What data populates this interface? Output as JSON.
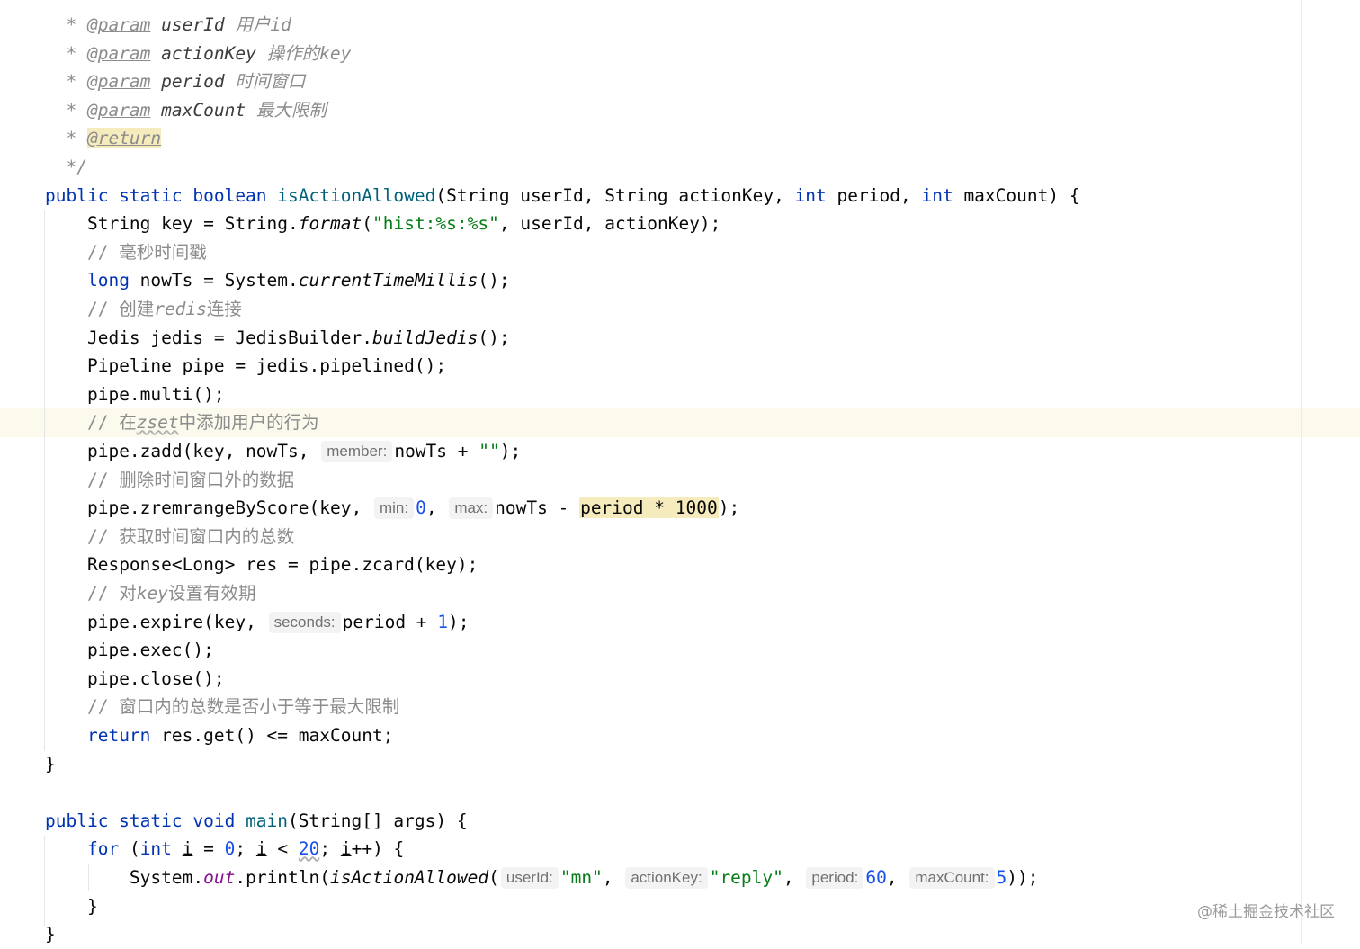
{
  "editor": {
    "lines": [
      {
        "indent": "  ",
        "tokens": [
          {
            "c": "cmt-it",
            "t": "* "
          },
          {
            "c": "doctag",
            "t": "@param"
          },
          {
            "c": "t",
            "t": " "
          },
          {
            "c": "docparam",
            "t": "userId"
          },
          {
            "c": "cmt-it",
            "t": " 用户id"
          }
        ]
      },
      {
        "indent": "  ",
        "tokens": [
          {
            "c": "cmt-it",
            "t": "* "
          },
          {
            "c": "doctag",
            "t": "@param"
          },
          {
            "c": "t",
            "t": " "
          },
          {
            "c": "docparam",
            "t": "actionKey"
          },
          {
            "c": "cmt-it",
            "t": " 操作的key"
          }
        ]
      },
      {
        "indent": "  ",
        "tokens": [
          {
            "c": "cmt-it",
            "t": "* "
          },
          {
            "c": "doctag",
            "t": "@param"
          },
          {
            "c": "t",
            "t": " "
          },
          {
            "c": "docparam",
            "t": "period"
          },
          {
            "c": "cmt-it",
            "t": " 时间窗口"
          }
        ]
      },
      {
        "indent": "  ",
        "tokens": [
          {
            "c": "cmt-it",
            "t": "* "
          },
          {
            "c": "doctag",
            "t": "@param"
          },
          {
            "c": "t",
            "t": " "
          },
          {
            "c": "docparam",
            "t": "maxCount"
          },
          {
            "c": "cmt-it",
            "t": " 最大限制"
          }
        ]
      },
      {
        "indent": "  ",
        "tokens": [
          {
            "c": "cmt-it",
            "t": "* "
          },
          {
            "c": "doctag hl-ret",
            "t": "@return"
          }
        ]
      },
      {
        "indent": "  ",
        "tokens": [
          {
            "c": "cmt-it",
            "t": "*/"
          }
        ]
      },
      {
        "indent": "",
        "tokens": [
          {
            "c": "kw",
            "t": "public static boolean "
          },
          {
            "c": "fn",
            "t": "isActionAllowed"
          },
          {
            "c": "t",
            "t": "(String userId, String actionKey, "
          },
          {
            "c": "kw",
            "t": "int"
          },
          {
            "c": "t",
            "t": " period, "
          },
          {
            "c": "kw",
            "t": "int"
          },
          {
            "c": "t",
            "t": " maxCount) {"
          }
        ]
      },
      {
        "indent": "    ",
        "tokens": [
          {
            "c": "t",
            "t": "String key = String."
          },
          {
            "c": "static-call",
            "t": "format"
          },
          {
            "c": "t",
            "t": "("
          },
          {
            "c": "str",
            "t": "\"hist:%s:%s\""
          },
          {
            "c": "t",
            "t": ", userId, actionKey);"
          }
        ]
      },
      {
        "indent": "    ",
        "tokens": [
          {
            "c": "cmt",
            "t": "// 毫秒时间戳"
          }
        ]
      },
      {
        "indent": "    ",
        "tokens": [
          {
            "c": "kw",
            "t": "long"
          },
          {
            "c": "t",
            "t": " nowTs = System."
          },
          {
            "c": "static-call",
            "t": "currentTimeMillis"
          },
          {
            "c": "t",
            "t": "();"
          }
        ]
      },
      {
        "indent": "    ",
        "tokens": [
          {
            "c": "cmt",
            "t": "// 创建"
          },
          {
            "c": "cmt-it",
            "t": "redis"
          },
          {
            "c": "cmt",
            "t": "连接"
          }
        ]
      },
      {
        "indent": "    ",
        "tokens": [
          {
            "c": "t",
            "t": "Jedis jedis = JedisBuilder."
          },
          {
            "c": "static-call",
            "t": "buildJedis"
          },
          {
            "c": "t",
            "t": "();"
          }
        ]
      },
      {
        "indent": "    ",
        "tokens": [
          {
            "c": "t",
            "t": "Pipeline pipe = jedis.pipelined();"
          }
        ]
      },
      {
        "indent": "    ",
        "tokens": [
          {
            "c": "t",
            "t": "pipe.multi();"
          }
        ]
      },
      {
        "indent": "    ",
        "caret": true,
        "tokens": [
          {
            "c": "cmt",
            "t": "// 在"
          },
          {
            "c": "cmt-it squig",
            "t": "zset"
          },
          {
            "c": "cmt",
            "t": "中添加用户的行为"
          }
        ]
      },
      {
        "indent": "    ",
        "tokens": [
          {
            "c": "t",
            "t": "pipe.zadd(key, nowTs, "
          },
          {
            "c": "hint",
            "t": "member:"
          },
          {
            "c": "t",
            "t": "nowTs + "
          },
          {
            "c": "str",
            "t": "\"\""
          },
          {
            "c": "t",
            "t": ");"
          }
        ]
      },
      {
        "indent": "    ",
        "tokens": [
          {
            "c": "cmt",
            "t": "// 删除时间窗口外的数据"
          }
        ]
      },
      {
        "indent": "    ",
        "tokens": [
          {
            "c": "t",
            "t": "pipe.zremrangeByScore(key, "
          },
          {
            "c": "hint",
            "t": "min:"
          },
          {
            "c": "num",
            "t": "0"
          },
          {
            "c": "t",
            "t": ", "
          },
          {
            "c": "hint",
            "t": "max:"
          },
          {
            "c": "t",
            "t": "nowTs - "
          },
          {
            "c": "hl-occ",
            "t": "period * 1000"
          },
          {
            "c": "t",
            "t": ");"
          }
        ]
      },
      {
        "indent": "    ",
        "tokens": [
          {
            "c": "cmt",
            "t": "// 获取时间窗口内的总数"
          }
        ]
      },
      {
        "indent": "    ",
        "tokens": [
          {
            "c": "t",
            "t": "Response<Long> res = pipe.zcard(key);"
          }
        ]
      },
      {
        "indent": "    ",
        "tokens": [
          {
            "c": "cmt",
            "t": "// 对"
          },
          {
            "c": "cmt-it",
            "t": "key"
          },
          {
            "c": "cmt",
            "t": "设置有效期"
          }
        ]
      },
      {
        "indent": "    ",
        "tokens": [
          {
            "c": "t",
            "t": "pipe."
          },
          {
            "c": "deprecated",
            "t": "expire"
          },
          {
            "c": "t",
            "t": "(key, "
          },
          {
            "c": "hint",
            "t": "seconds:"
          },
          {
            "c": "t",
            "t": "period + "
          },
          {
            "c": "num",
            "t": "1"
          },
          {
            "c": "t",
            "t": ");"
          }
        ]
      },
      {
        "indent": "    ",
        "tokens": [
          {
            "c": "t",
            "t": "pipe.exec();"
          }
        ]
      },
      {
        "indent": "    ",
        "tokens": [
          {
            "c": "t",
            "t": "pipe.close();"
          }
        ]
      },
      {
        "indent": "    ",
        "tokens": [
          {
            "c": "cmt",
            "t": "// 窗口内的总数是否小于等于最大限制"
          }
        ]
      },
      {
        "indent": "    ",
        "tokens": [
          {
            "c": "kw",
            "t": "return"
          },
          {
            "c": "t",
            "t": " res.get() <= maxCount;"
          }
        ]
      },
      {
        "indent": "",
        "tokens": [
          {
            "c": "t",
            "t": "}"
          }
        ]
      },
      {
        "indent": "",
        "tokens": []
      },
      {
        "indent": "",
        "tokens": [
          {
            "c": "kw",
            "t": "public static void "
          },
          {
            "c": "fn",
            "t": "main"
          },
          {
            "c": "t",
            "t": "(String[] args) {"
          }
        ]
      },
      {
        "indent": "    ",
        "tokens": [
          {
            "c": "kw",
            "t": "for"
          },
          {
            "c": "t",
            "t": " ("
          },
          {
            "c": "kw",
            "t": "int"
          },
          {
            "c": "t",
            "t": " "
          },
          {
            "c": "uvar",
            "t": "i"
          },
          {
            "c": "t",
            "t": " = "
          },
          {
            "c": "num",
            "t": "0"
          },
          {
            "c": "t",
            "t": "; "
          },
          {
            "c": "uvar",
            "t": "i"
          },
          {
            "c": "t",
            "t": " < "
          },
          {
            "c": "num squig",
            "t": "20"
          },
          {
            "c": "t",
            "t": "; "
          },
          {
            "c": "uvar",
            "t": "i"
          },
          {
            "c": "t",
            "t": "++) {"
          }
        ]
      },
      {
        "indent": "        ",
        "tokens": [
          {
            "c": "t",
            "t": "System."
          },
          {
            "c": "field",
            "t": "out"
          },
          {
            "c": "t",
            "t": ".println("
          },
          {
            "c": "static-call",
            "t": "isActionAllowed"
          },
          {
            "c": "t",
            "t": "("
          },
          {
            "c": "hint",
            "t": "userId:"
          },
          {
            "c": "str",
            "t": "\"mn\""
          },
          {
            "c": "t",
            "t": ", "
          },
          {
            "c": "hint",
            "t": "actionKey:"
          },
          {
            "c": "str",
            "t": "\"reply\""
          },
          {
            "c": "t",
            "t": ", "
          },
          {
            "c": "hint",
            "t": "period:"
          },
          {
            "c": "num",
            "t": "60"
          },
          {
            "c": "t",
            "t": ", "
          },
          {
            "c": "hint",
            "t": "maxCount:"
          },
          {
            "c": "num",
            "t": "5"
          },
          {
            "c": "t",
            "t": "));"
          }
        ]
      },
      {
        "indent": "    ",
        "tokens": [
          {
            "c": "t",
            "t": "}"
          }
        ]
      },
      {
        "indent": "",
        "tokens": [
          {
            "c": "t",
            "t": "}"
          }
        ]
      }
    ]
  },
  "watermark": "@稀土掘金技术社区"
}
